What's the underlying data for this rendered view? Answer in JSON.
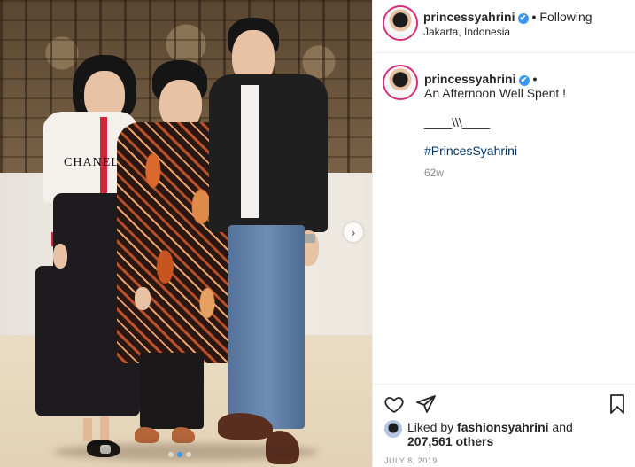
{
  "post": {
    "username": "princessyahrini",
    "location": "Jakarta, Indonesia",
    "follow_state": "Following",
    "separator": "•",
    "verified_glyph": "✔"
  },
  "caption": {
    "username": "princessyahrini",
    "line1": "An Afternoon Well Spent !",
    "line2": "____\\\\\\____",
    "hashtag": "#PrincesSyahrini",
    "age": "62w"
  },
  "likes": {
    "prefix": "Liked by",
    "user": "fashionsyahrini",
    "connector": "and",
    "count": "207,561 others"
  },
  "date": "JULY 8, 2019",
  "photo": {
    "cardigan_text": "CHANEL",
    "carousel": {
      "current": 2,
      "total": 3
    }
  },
  "icons": [
    "heart-icon",
    "share-icon",
    "bookmark-icon",
    "chevron-right-icon",
    "verified-badge-icon"
  ]
}
